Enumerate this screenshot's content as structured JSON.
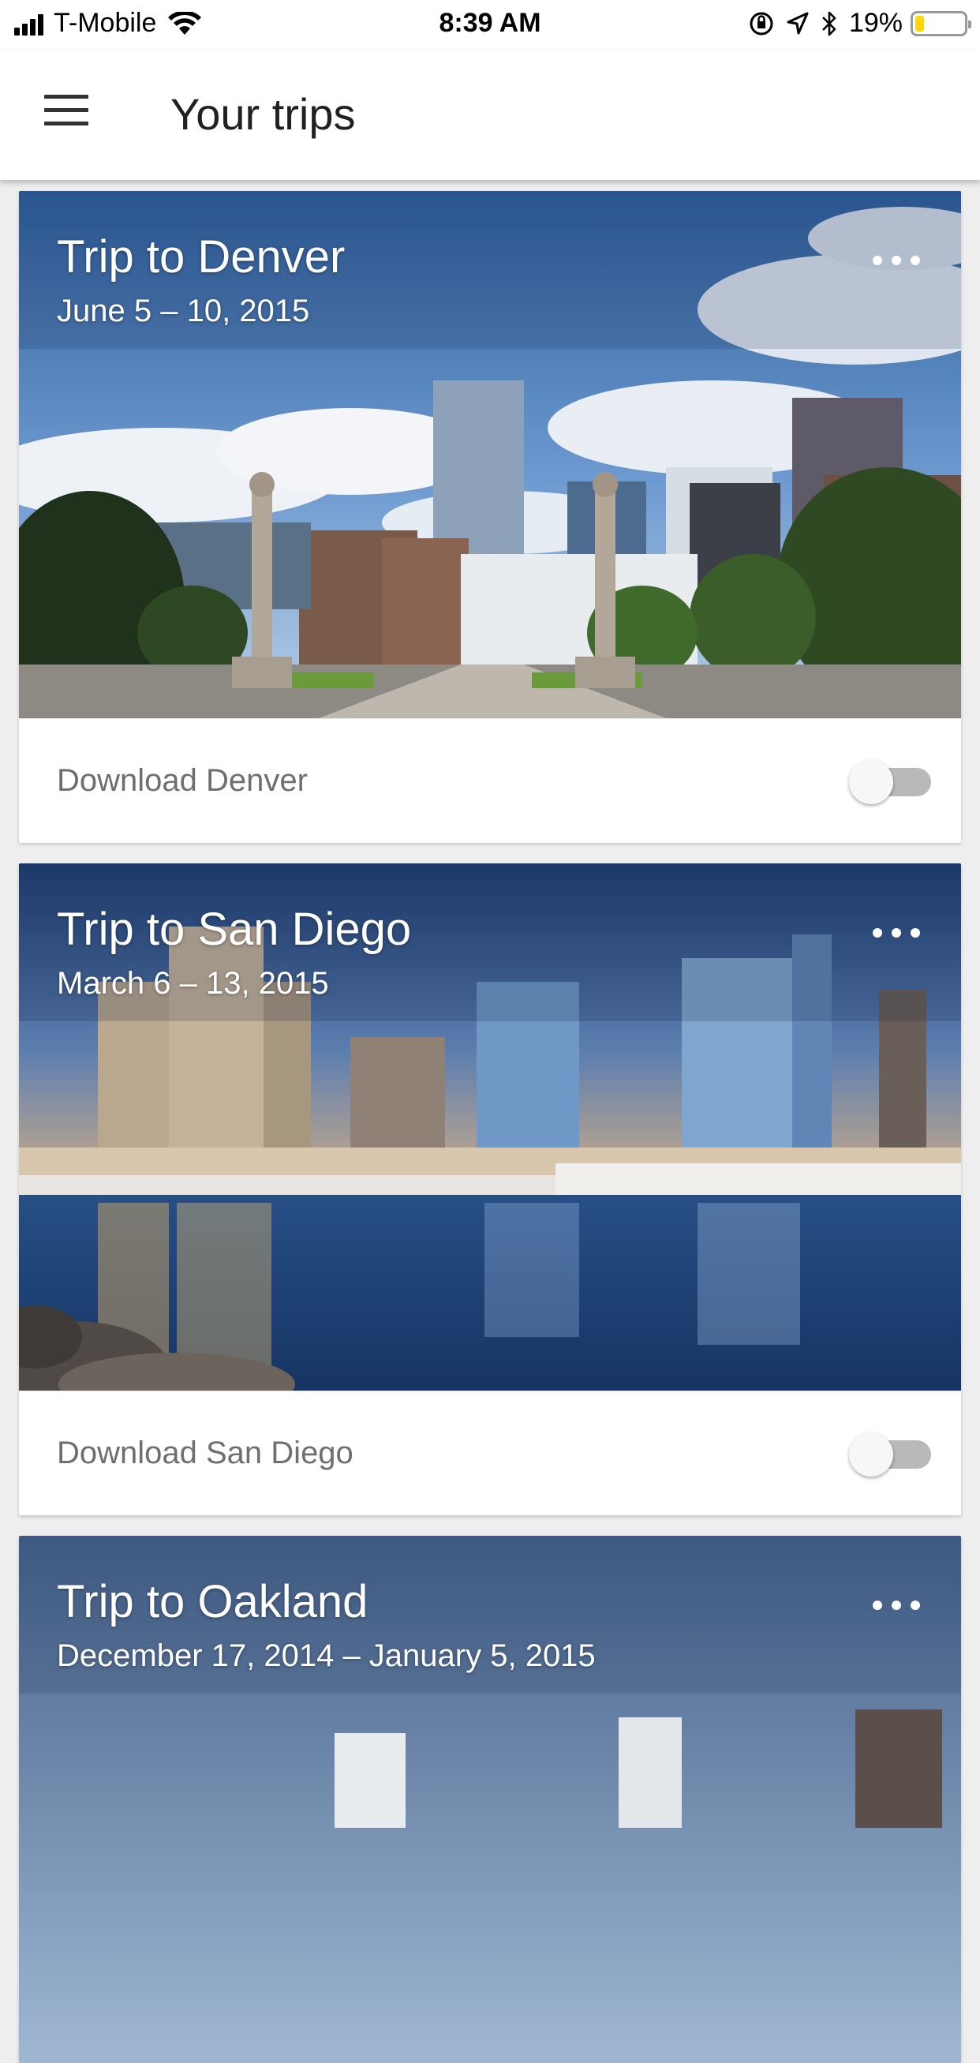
{
  "status_bar": {
    "carrier": "T-Mobile",
    "time": "8:39 AM",
    "battery_percent": "19%",
    "battery_level": 0.19,
    "icons": [
      "signal-icon",
      "wifi-icon",
      "orientation-lock-icon",
      "location-arrow-icon",
      "bluetooth-icon",
      "battery-icon"
    ]
  },
  "app_bar": {
    "title": "Your trips",
    "menu_icon": "hamburger-menu-icon"
  },
  "trips": [
    {
      "title": "Trip to Denver",
      "dates": "June 5 – 10, 2015",
      "download_label": "Download Denver",
      "download_enabled": false,
      "image": "denver-skyline-photo"
    },
    {
      "title": "Trip to San Diego",
      "dates": "March 6 – 13, 2015",
      "download_label": "Download San Diego",
      "download_enabled": false,
      "image": "san-diego-marina-photo"
    },
    {
      "title": "Trip to Oakland",
      "dates": "December 17, 2014 – January 5, 2015",
      "image": "oakland-skyline-photo"
    }
  ],
  "colors": {
    "app_bar_bg": "#ffffff",
    "page_bg": "#eeeeee",
    "toggle_off_track": "#b9b9b9",
    "label_gray": "#6f6f6f"
  }
}
